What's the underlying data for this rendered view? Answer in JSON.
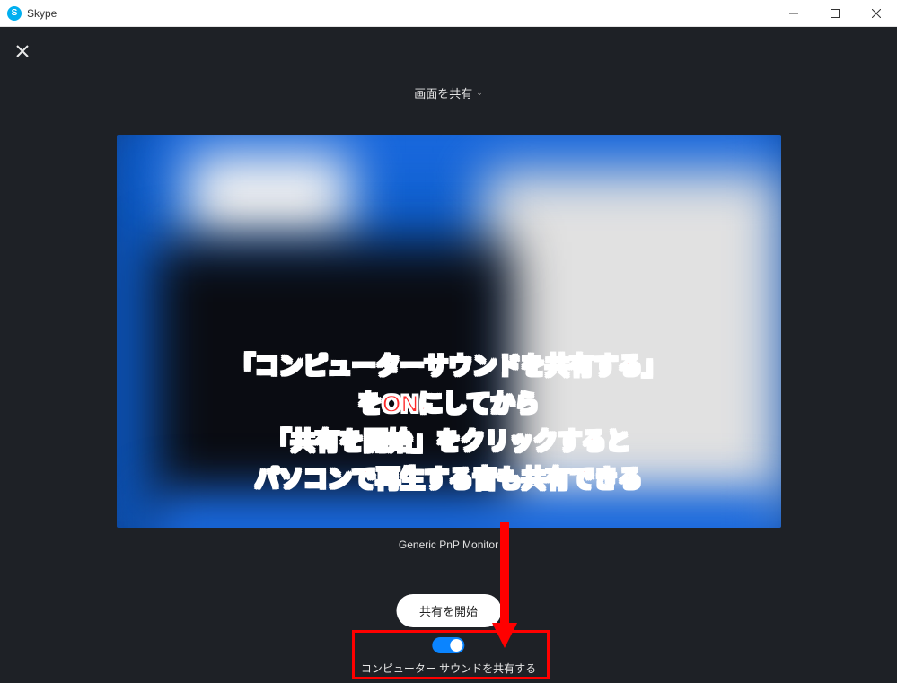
{
  "titlebar": {
    "app_name": "Skype"
  },
  "share": {
    "dropdown_label": "画面を共有",
    "monitor_name": "Generic PnP Monitor",
    "start_button": "共有を開始",
    "sound_toggle_label": "コンピューター サウンドを共有する",
    "sound_toggle_on": true
  },
  "annotation": {
    "line1": "「コンピューターサウンドを共有する」",
    "line2": "をONにしてから",
    "line3": "「共有を開始」をクリックすると",
    "line4": "パソコンで再生する音も共有できる"
  }
}
